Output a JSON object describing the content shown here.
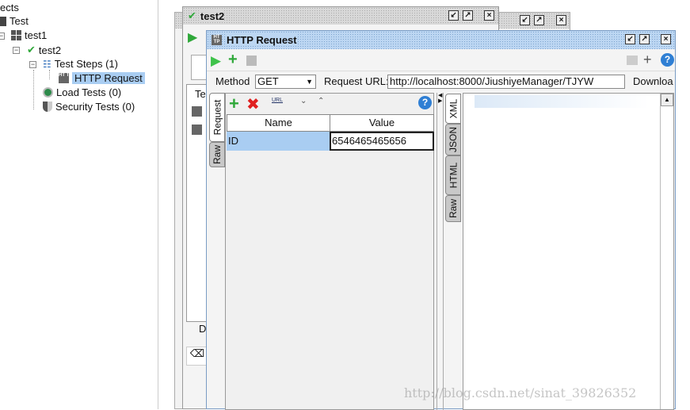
{
  "tree": {
    "header": "ects",
    "items": [
      {
        "label": "Test",
        "icon": "folder-icon"
      },
      {
        "label": "test1",
        "icon": "testsuite-icon"
      },
      {
        "label": "test2",
        "icon": "check-icon"
      },
      {
        "label": "Test Steps (1)",
        "icon": "list-icon"
      },
      {
        "label": "HTTP Request",
        "icon": "http-icon"
      },
      {
        "label": "Load Tests (0)",
        "icon": "load-test-icon"
      },
      {
        "label": "Security Tests (0)",
        "icon": "shield-icon"
      }
    ]
  },
  "back_window": {
    "title": "test2",
    "tab_partial": "Tes",
    "bottom_partial": "D"
  },
  "http_window": {
    "title": "HTTP Request",
    "method_label": "Method",
    "method_value": "GET",
    "url_label": "Request URL:",
    "url_value": "http://localhost:8000/JiushiyeManager/TJYW",
    "download_label": "Downloa",
    "left_tabs": [
      "Request",
      "Raw"
    ],
    "table": {
      "headers": [
        "Name",
        "Value"
      ],
      "rows": [
        [
          "ID",
          "6546465465656"
        ]
      ]
    },
    "right_tabs": [
      "XML",
      "JSON",
      "HTML",
      "Raw"
    ]
  },
  "watermark": "http://blog.csdn.net/sinat_39826352",
  "colors": {
    "accent": "#b8d4f4",
    "selection": "#a9cdf2",
    "green": "#2fa83a",
    "red": "#e02020"
  }
}
